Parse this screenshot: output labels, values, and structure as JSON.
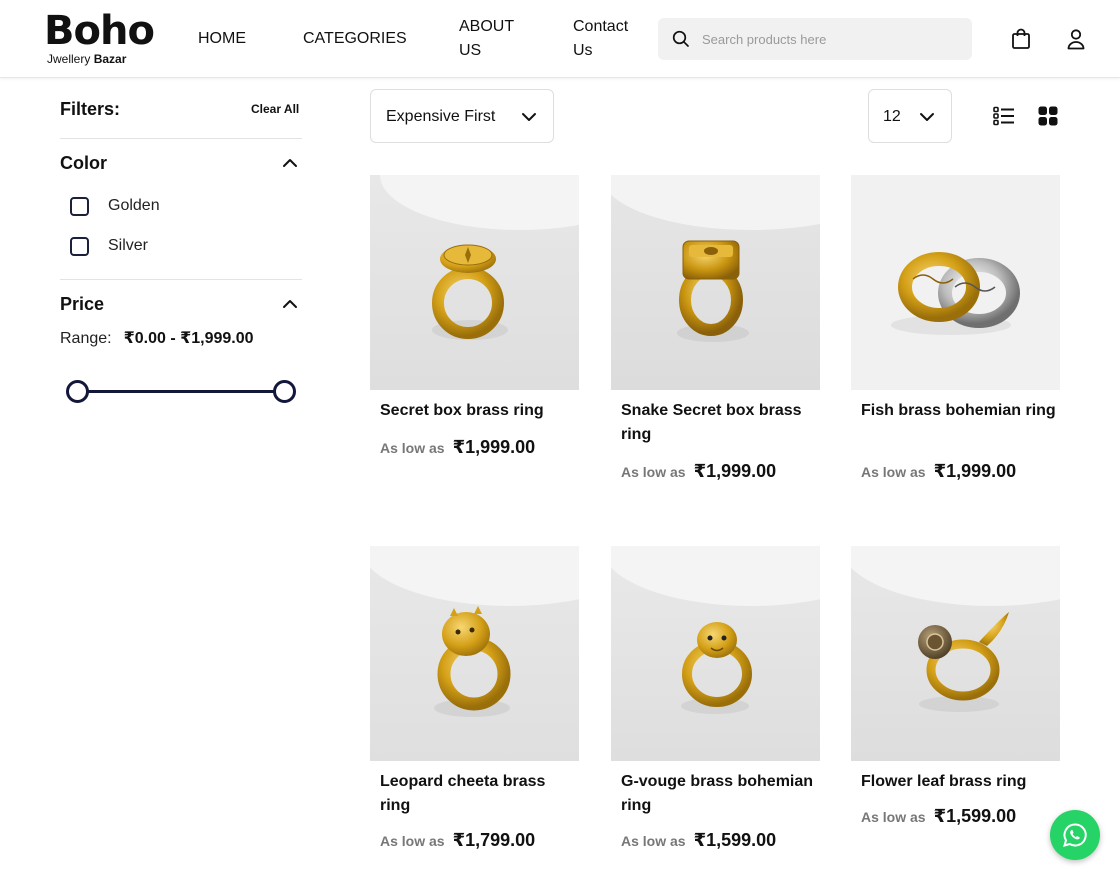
{
  "header": {
    "logo_main": "Boho",
    "logo_sub_prefix": "Jwellery",
    "logo_sub_bold": "Bazar",
    "nav": {
      "home": "HOME",
      "categories": "CATEGORIES",
      "about_line1": "ABOUT",
      "about_line2": "US",
      "contact_line1": "Contact",
      "contact_line2": "Us"
    },
    "search_placeholder": "Search products here",
    "icons": [
      "search-icon",
      "shopping-bag-icon",
      "user-icon"
    ]
  },
  "sidebar": {
    "filters_title": "Filters:",
    "clear_all": "Clear All",
    "color": {
      "title": "Color",
      "options": [
        "Golden",
        "Silver"
      ]
    },
    "price": {
      "title": "Price",
      "range_label": "Range:",
      "range_value": "₹0.00 - ₹1,999.00",
      "slider_min_fraction": 0,
      "slider_max_fraction": 1
    }
  },
  "toolbar": {
    "sort_selected": "Expensive First",
    "per_page_selected": "12",
    "views": [
      "list-view-icon",
      "grid-view-icon"
    ],
    "active_view": "grid"
  },
  "products": [
    {
      "name": "Secret box brass ring",
      "as_low_as": "As low as",
      "price": "₹1,999.00"
    },
    {
      "name": "Snake Secret box brass ring",
      "as_low_as": "As low as",
      "price": "₹1,999.00"
    },
    {
      "name": "Fish brass bohemian ring",
      "as_low_as": "As low as",
      "price": "₹1,999.00"
    },
    {
      "name": "Leopard cheeta brass ring",
      "as_low_as": "As low as",
      "price": "₹1,799.00"
    },
    {
      "name": "G-vouge brass bohemian ring",
      "as_low_as": "As low as",
      "price": "₹1,599.00"
    },
    {
      "name": "Flower leaf brass ring",
      "as_low_as": "As low as",
      "price": "₹1,599.00"
    }
  ],
  "colors": {
    "accent_dark": "#13173a",
    "whatsapp": "#25d366",
    "gold": "#d4a017"
  }
}
